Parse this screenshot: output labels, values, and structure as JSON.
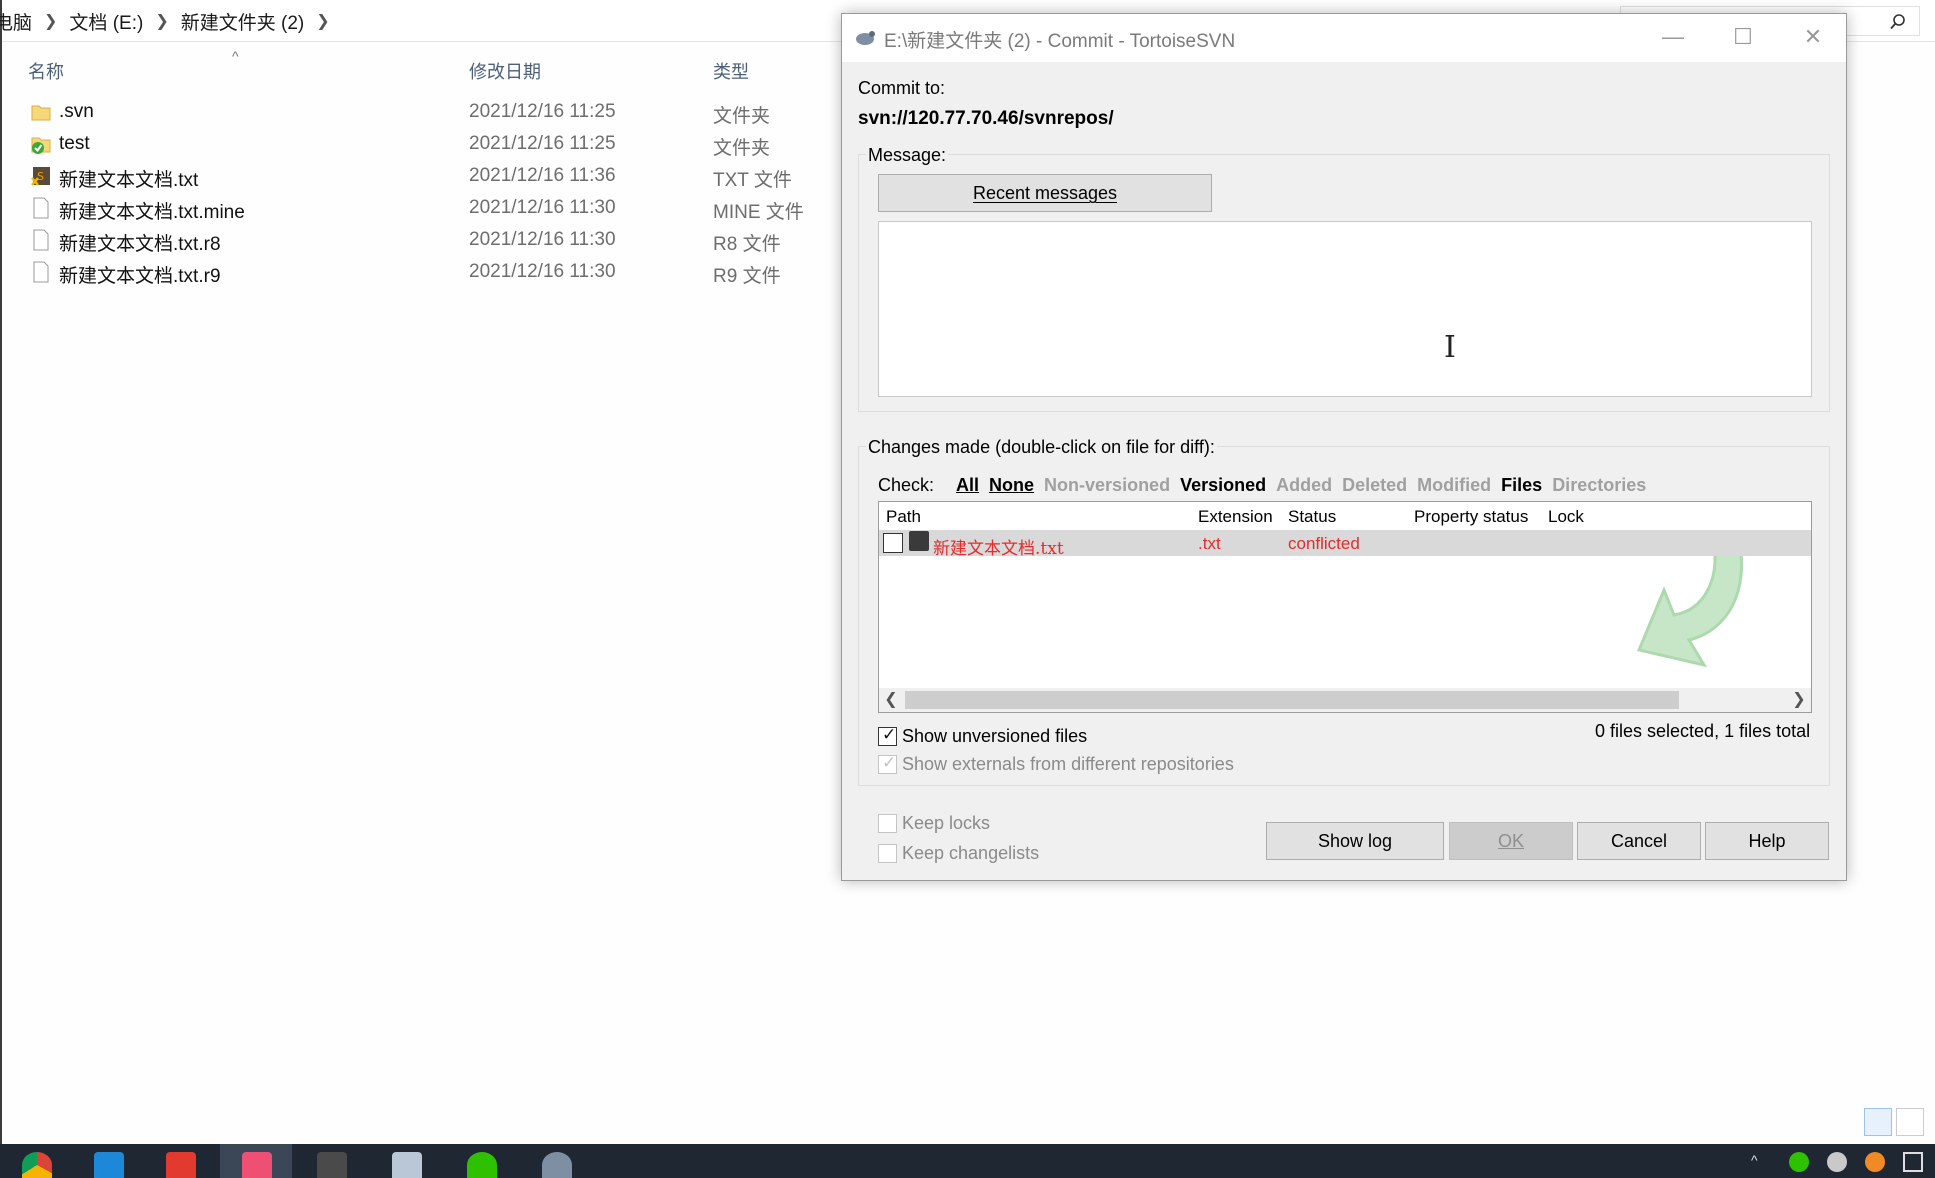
{
  "explorer": {
    "breadcrumb": [
      "电脑",
      "文档 (E:)",
      "新建文件夹 (2)"
    ],
    "columns": {
      "name": "名称",
      "date": "修改日期",
      "type": "类型"
    },
    "files": [
      {
        "name": ".svn",
        "date": "2021/12/16 11:25",
        "type": "文件夹",
        "icon": "folder-icon"
      },
      {
        "name": "test",
        "date": "2021/12/16 11:25",
        "type": "文件夹",
        "icon": "svn-normal-folder-icon"
      },
      {
        "name": "新建文本文档.txt",
        "date": "2021/12/16 11:36",
        "type": "TXT 文件",
        "icon": "svn-conflict-file-icon"
      },
      {
        "name": "新建文本文档.txt.mine",
        "date": "2021/12/16 11:30",
        "type": "MINE 文件",
        "icon": "file-icon"
      },
      {
        "name": "新建文本文档.txt.r8",
        "date": "2021/12/16 11:30",
        "type": "R8 文件",
        "icon": "file-icon"
      },
      {
        "name": "新建文本文档.txt.r9",
        "date": "2021/12/16 11:30",
        "type": "R9 文件",
        "icon": "file-icon"
      }
    ]
  },
  "dialog": {
    "title": "E:\\新建文件夹 (2) - Commit - TortoiseSVN",
    "commit_to_label": "Commit to:",
    "repo_url": "svn://120.77.70.46/svnrepos/",
    "message_label": "Message:",
    "recent_messages_button": "Recent messages",
    "message_value": "",
    "changes_label": "Changes made (double-click on file for diff):",
    "check_label": "Check:",
    "check_filters": [
      {
        "label": "All",
        "active": true
      },
      {
        "label": "None",
        "active": true
      },
      {
        "label": "Non-versioned",
        "active": false
      },
      {
        "label": "Versioned",
        "active": true
      },
      {
        "label": "Added",
        "active": false
      },
      {
        "label": "Deleted",
        "active": false
      },
      {
        "label": "Modified",
        "active": false
      },
      {
        "label": "Files",
        "active": true
      },
      {
        "label": "Directories",
        "active": false
      }
    ],
    "list_columns": {
      "path": "Path",
      "extension": "Extension",
      "status": "Status",
      "property_status": "Property status",
      "lock": "Lock"
    },
    "list_rows": [
      {
        "path": "新建文本文档.txt",
        "extension": ".txt",
        "status": "conflicted",
        "checked": false
      }
    ],
    "status_colors": {
      "conflicted": "#e32b2b"
    },
    "show_unversioned": {
      "label": "Show unversioned files",
      "checked": true
    },
    "show_externals": {
      "label": "Show externals from different repositories",
      "checked": true,
      "enabled": false
    },
    "selection_summary": "0 files selected, 1 files total",
    "keep_locks": {
      "label": "Keep locks",
      "checked": false
    },
    "keep_changelists": {
      "label": "Keep changelists",
      "checked": false
    },
    "buttons": {
      "show_log": "Show log",
      "ok": "OK",
      "cancel": "Cancel",
      "help": "Help"
    }
  },
  "taskbar": {
    "apps": [
      "chrome-icon",
      "vscode-icon",
      "wps-icon",
      "screen-recorder-icon",
      "sublime-text-icon",
      "task-manager-icon",
      "wechat-icon",
      "tortoisesvn-icon"
    ]
  }
}
